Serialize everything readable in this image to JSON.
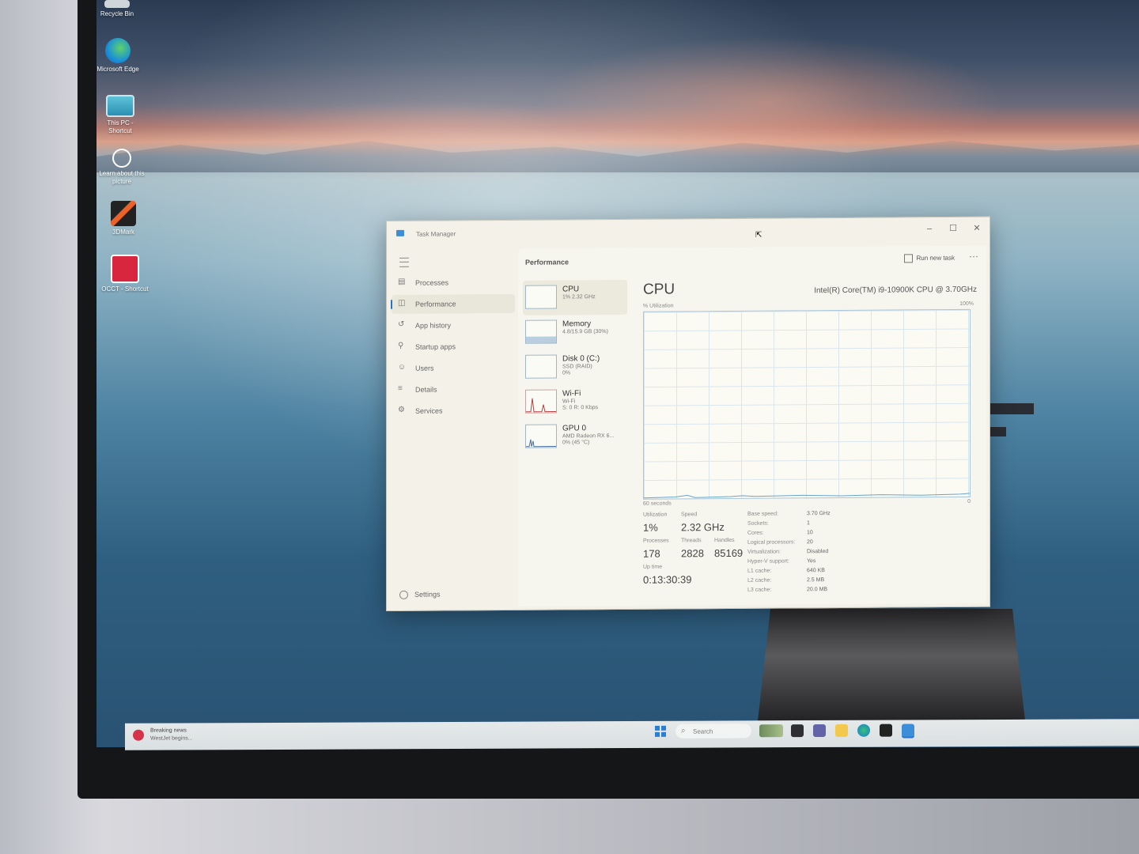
{
  "desktop": {
    "icons": [
      {
        "label": "Recycle Bin",
        "icon": "recycle-bin-icon"
      },
      {
        "label": "Microsoft Edge",
        "icon": "edge-icon"
      },
      {
        "label": "This PC - Shortcut",
        "icon": "this-pc-icon"
      },
      {
        "label": "Learn about this picture",
        "icon": "camera-icon"
      },
      {
        "label": "3DMark",
        "icon": "3dmark-icon"
      },
      {
        "label": "OCCT - Shortcut",
        "icon": "occt-icon"
      }
    ]
  },
  "window": {
    "title": "Task Manager",
    "minimize": "–",
    "maximize": "☐",
    "close": "✕"
  },
  "nav": {
    "items": [
      {
        "label": "Processes",
        "icon": "processes-icon"
      },
      {
        "label": "Performance",
        "icon": "performance-icon",
        "active": true
      },
      {
        "label": "App history",
        "icon": "history-icon"
      },
      {
        "label": "Startup apps",
        "icon": "startup-icon"
      },
      {
        "label": "Users",
        "icon": "users-icon"
      },
      {
        "label": "Details",
        "icon": "details-icon"
      },
      {
        "label": "Services",
        "icon": "services-icon"
      }
    ],
    "settings": "Settings"
  },
  "header": {
    "title": "Performance",
    "run_new_task": "Run new task",
    "more": "···"
  },
  "devices": [
    {
      "name": "CPU",
      "sub1": "1% 2.32 GHz",
      "sub2": ""
    },
    {
      "name": "Memory",
      "sub1": "4.8/15.9 GB (30%)",
      "sub2": ""
    },
    {
      "name": "Disk 0 (C:)",
      "sub1": "SSD (RAID)",
      "sub2": "0%"
    },
    {
      "name": "Wi-Fi",
      "sub1": "Wi-Fi",
      "sub2": "S: 0 R: 0 Kbps"
    },
    {
      "name": "GPU 0",
      "sub1": "AMD Radeon RX 6...",
      "sub2": "0% (45 °C)"
    }
  ],
  "cpu": {
    "title": "CPU",
    "model": "Intel(R) Core(TM) i9-10900K CPU @ 3.70GHz",
    "utilization_label": "% Utilization",
    "max_label": "100%",
    "time_label": "60 seconds",
    "min_label": "0",
    "stats": {
      "utilization_label": "Utilization",
      "utilization": "1%",
      "speed_label": "Speed",
      "speed": "2.32 GHz",
      "processes_label": "Processes",
      "processes": "178",
      "threads_label": "Threads",
      "threads": "2828",
      "handles_label": "Handles",
      "handles": "85169",
      "uptime_label": "Up time",
      "uptime": "0:13:30:39"
    },
    "specs": [
      {
        "label": "Base speed:",
        "value": "3.70 GHz"
      },
      {
        "label": "Sockets:",
        "value": "1"
      },
      {
        "label": "Cores:",
        "value": "10"
      },
      {
        "label": "Logical processors:",
        "value": "20"
      },
      {
        "label": "Virtualization:",
        "value": "Disabled"
      },
      {
        "label": "Hyper-V support:",
        "value": "Yes"
      },
      {
        "label": "L1 cache:",
        "value": "640 KB"
      },
      {
        "label": "L2 cache:",
        "value": "2.5 MB"
      },
      {
        "label": "L3 cache:",
        "value": "20.0 MB"
      }
    ]
  },
  "taskbar": {
    "news_title": "Breaking news",
    "news_sub": "WestJet begins...",
    "search_placeholder": "Search"
  },
  "colors": {
    "accent": "#2b72c9",
    "graph_line": "#6aa3c9",
    "window_bg": "#f4f2e8"
  }
}
